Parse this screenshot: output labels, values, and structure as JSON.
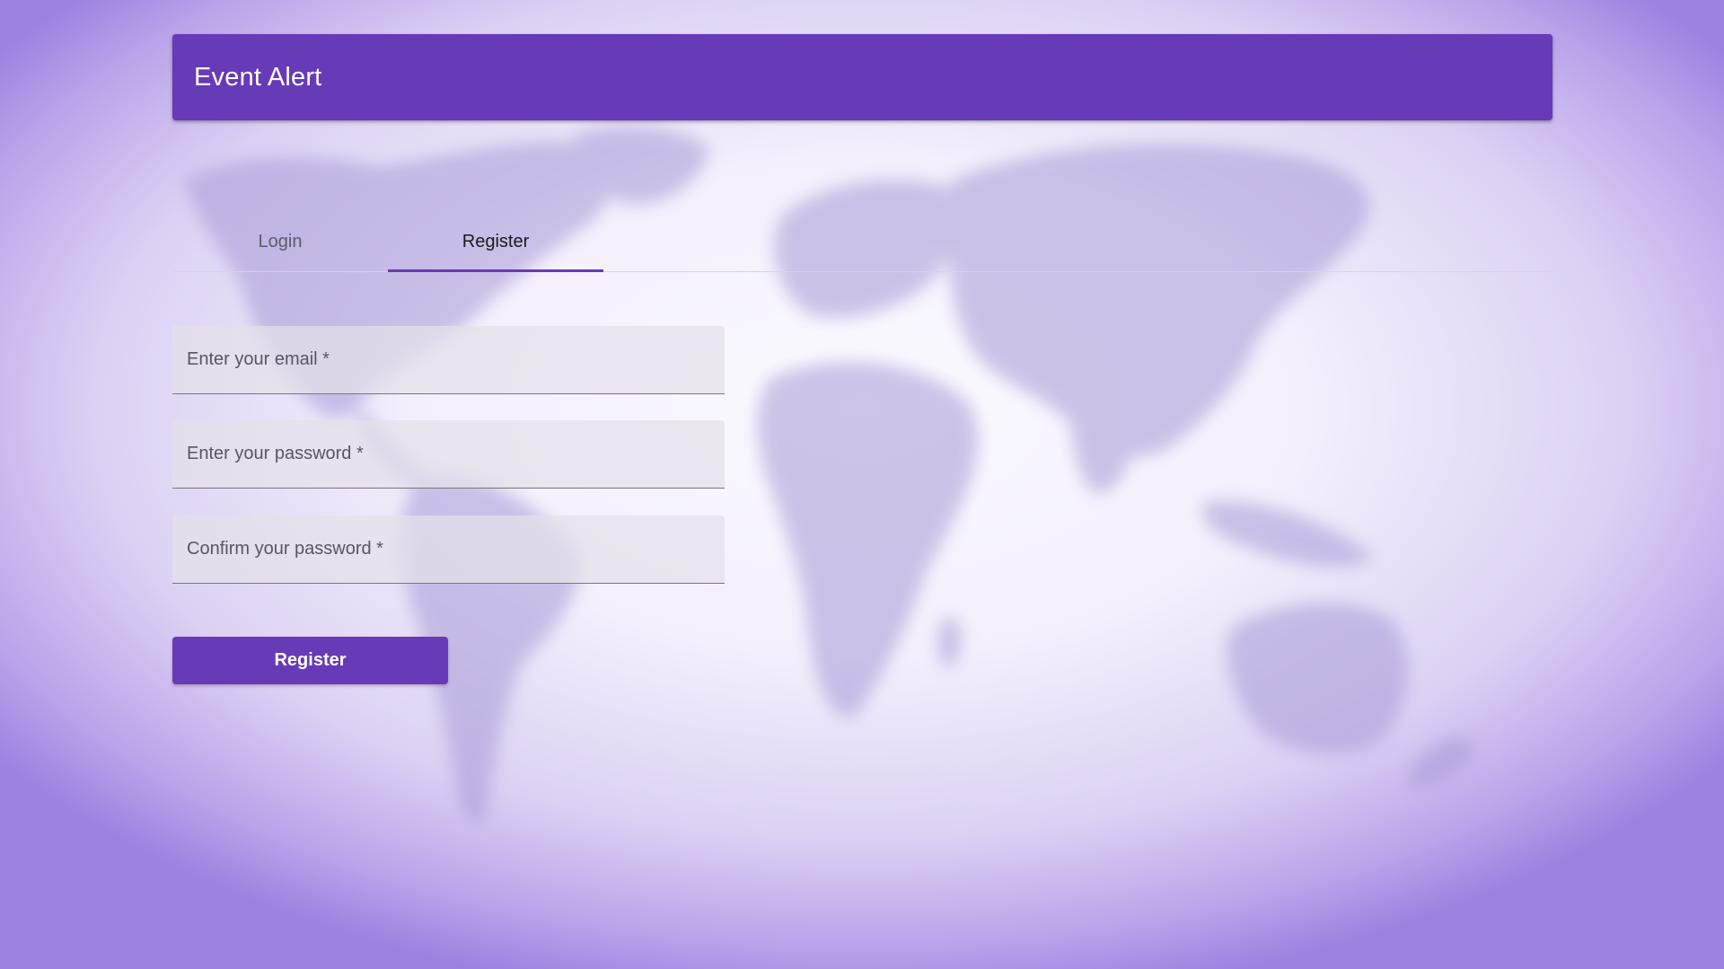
{
  "app": {
    "title": "Event Alert"
  },
  "tabs": [
    {
      "label": "Login",
      "active": false
    },
    {
      "label": "Register",
      "active": true
    }
  ],
  "form": {
    "email": {
      "placeholder": "Enter your email *",
      "value": ""
    },
    "password": {
      "placeholder": "Enter your password *",
      "value": ""
    },
    "confirm_password": {
      "placeholder": "Confirm your password *",
      "value": ""
    },
    "submit_label": "Register"
  },
  "colors": {
    "primary": "#673ab7",
    "on_primary": "#ffffff",
    "field_background": "#e4e1e9"
  }
}
